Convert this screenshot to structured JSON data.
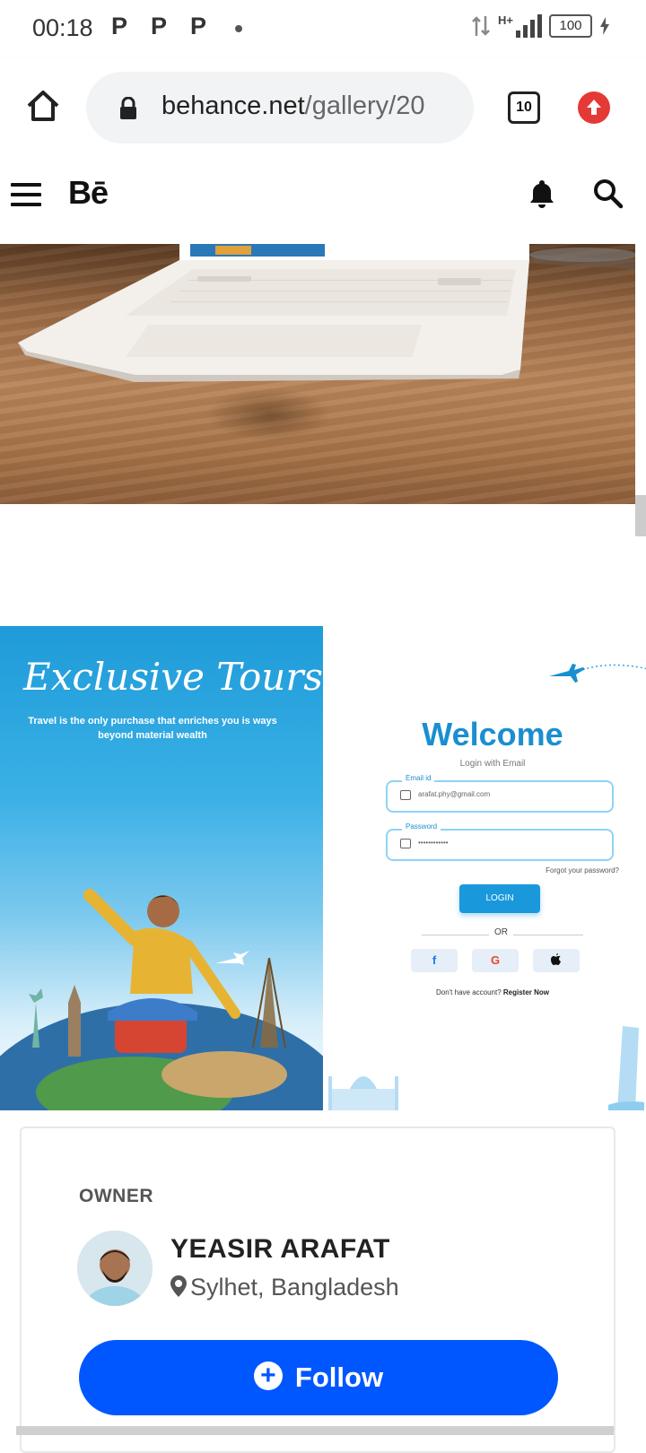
{
  "status_bar": {
    "time": "00:18",
    "notifications": [
      "P",
      "P",
      "P"
    ],
    "network": "H+",
    "battery": "100"
  },
  "browser": {
    "url_host": "behance.net",
    "url_path": "/gallery/20",
    "tab_count": "10"
  },
  "behance_header": {
    "logo": "Bē"
  },
  "showcase": {
    "left_panel": {
      "title": "Exclusive Tours",
      "tagline": "Travel is the only purchase that enriches you is ways beyond material wealth"
    },
    "login_mockup": {
      "welcome": "Welcome",
      "subtitle": "Login with Email",
      "email_label": "Email id",
      "email_value": "arafat.phy@gmail.com",
      "password_label": "Password",
      "password_value": "••••••••••••",
      "forgot": "Forgot your password?",
      "login_button": "LOGIN",
      "or": "OR",
      "social": [
        "f",
        "G",
        ""
      ],
      "register_prefix": "Don't have account?",
      "register_link": "Register Now"
    }
  },
  "owner": {
    "label": "OWNER",
    "name": "YEASIR ARAFAT",
    "location": "Sylhet, Bangladesh",
    "follow_label": "Follow"
  },
  "colors": {
    "follow_blue": "#0057ff",
    "welcome_blue": "#1a8fd0",
    "update_red": "#e53935"
  }
}
